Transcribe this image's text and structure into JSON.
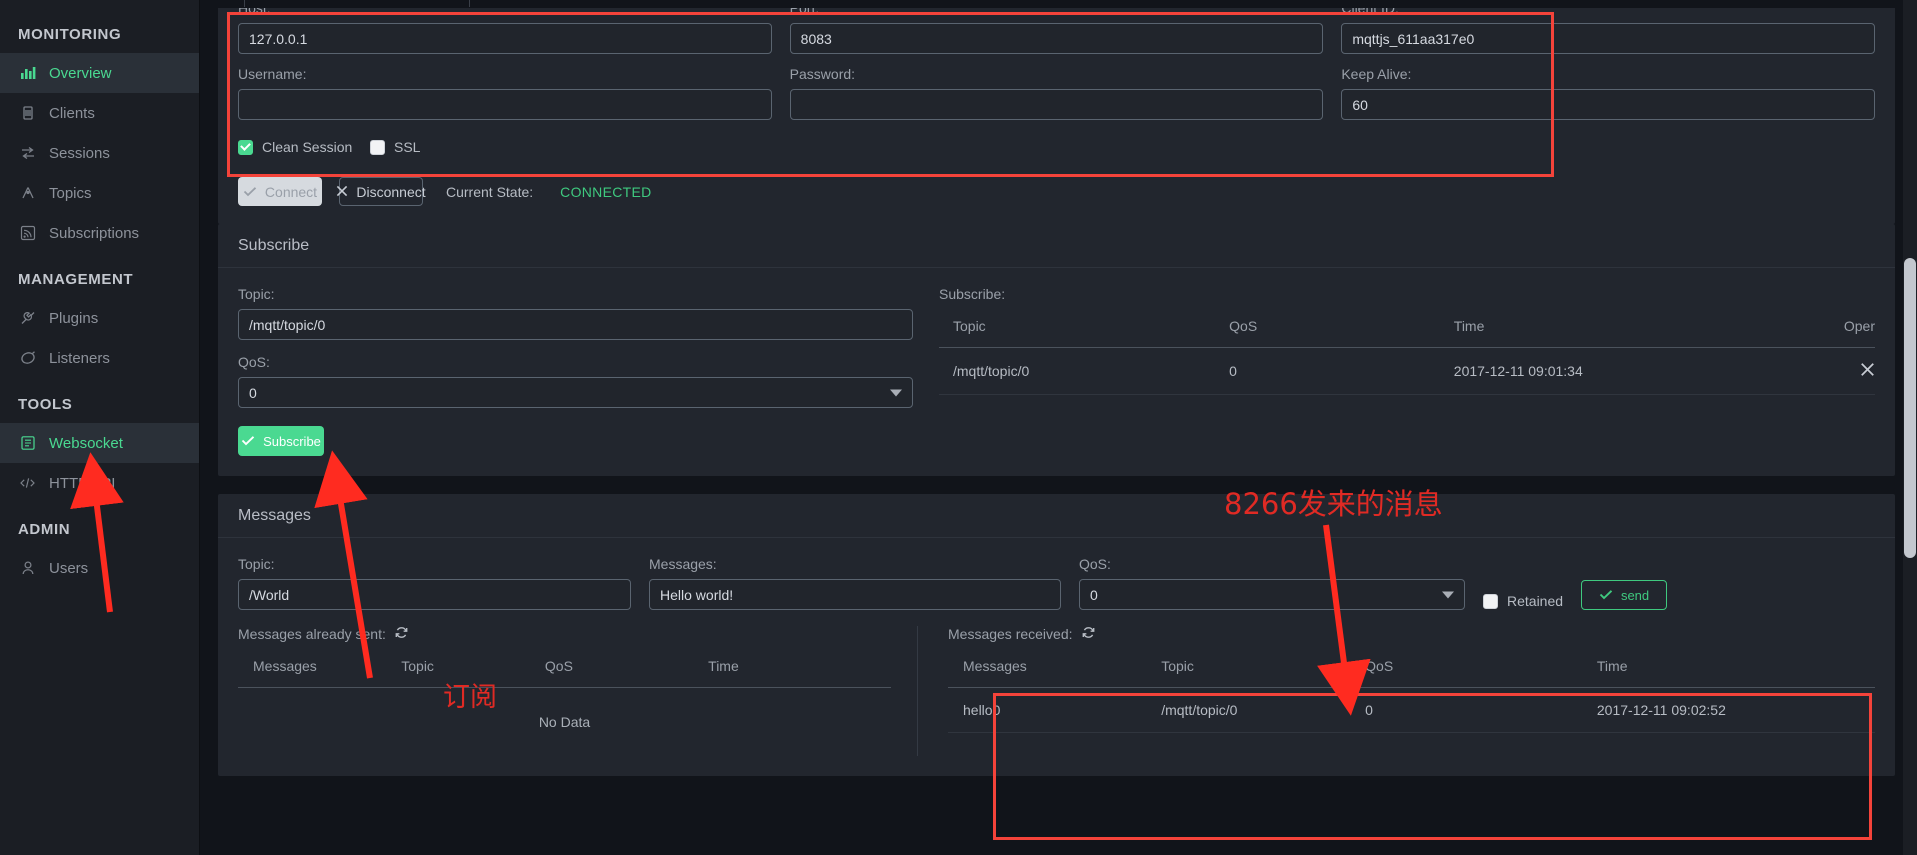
{
  "sidebar": {
    "groups": [
      {
        "title": "MONITORING",
        "items": [
          {
            "label": "Overview",
            "icon": "chart-bar-icon",
            "active": true
          },
          {
            "label": "Clients",
            "icon": "clients-icon",
            "active": false
          },
          {
            "label": "Sessions",
            "icon": "sessions-icon",
            "active": false
          },
          {
            "label": "Topics",
            "icon": "topics-icon",
            "active": false
          },
          {
            "label": "Subscriptions",
            "icon": "subscriptions-icon",
            "active": false
          }
        ]
      },
      {
        "title": "MANAGEMENT",
        "items": [
          {
            "label": "Plugins",
            "icon": "plugin-icon",
            "active": false
          },
          {
            "label": "Listeners",
            "icon": "listeners-icon",
            "active": false
          }
        ]
      },
      {
        "title": "TOOLS",
        "items": [
          {
            "label": "Websocket",
            "icon": "websocket-icon",
            "active": true
          },
          {
            "label": "HTTP API",
            "icon": "code-icon",
            "active": false
          }
        ]
      },
      {
        "title": "ADMIN",
        "items": [
          {
            "label": "Users",
            "icon": "user-icon",
            "active": false
          }
        ]
      }
    ]
  },
  "connection": {
    "host_label": "Host:",
    "host_value": "127.0.0.1",
    "port_label": "Port:",
    "port_value": "8083",
    "client_id_label": "Client ID:",
    "client_id_value": "mqttjs_611aa317e0",
    "username_label": "Username:",
    "username_value": "",
    "username_placeholder": "",
    "password_label": "Password:",
    "password_value": "",
    "password_placeholder": "",
    "keepalive_label": "Keep Alive:",
    "keepalive_value": "60",
    "clean_session_label": "Clean Session",
    "clean_session_checked": true,
    "ssl_label": "SSL",
    "ssl_checked": false,
    "connect_label": "Connect",
    "disconnect_label": "Disconnect",
    "current_state_label": "Current State:",
    "current_state_value": "CONNECTED",
    "state_color": "#3fc97f"
  },
  "subscribe": {
    "panel_title": "Subscribe",
    "topic_label": "Topic:",
    "topic_value": "/mqtt/topic/0",
    "qos_label": "QoS:",
    "qos_value": "0",
    "button_label": "Subscribe",
    "table_caption": "Subscribe:",
    "columns": [
      "Topic",
      "QoS",
      "Time",
      "Oper"
    ],
    "rows": [
      {
        "topic": "/mqtt/topic/0",
        "qos": "0",
        "time": "2017-12-11 09:01:34",
        "oper": "✕"
      }
    ]
  },
  "messages": {
    "panel_title": "Messages",
    "topic_label": "Topic:",
    "topic_value": "/World",
    "messages_label": "Messages:",
    "messages_value": "Hello world!",
    "qos_label": "QoS:",
    "qos_value": "0",
    "retained_label": "Retained",
    "retained_checked": false,
    "send_label": "send",
    "sent": {
      "caption": "Messages already sent:",
      "refresh_icon": "refresh-icon",
      "columns": [
        "Messages",
        "Topic",
        "QoS",
        "Time"
      ],
      "rows": [],
      "empty_text": "No Data"
    },
    "received": {
      "caption": "Messages received:",
      "refresh_icon": "refresh-icon",
      "columns": [
        "Messages",
        "Topic",
        "QoS",
        "Time"
      ],
      "rows": [
        {
          "messages": "hello0",
          "topic": "/mqtt/topic/0",
          "qos": "0",
          "time": "2017-12-11 09:02:52"
        }
      ]
    }
  },
  "annotations": {
    "color": "#e02a24",
    "note_received": "8266发来的消息",
    "note_subscribe": "订阅"
  }
}
